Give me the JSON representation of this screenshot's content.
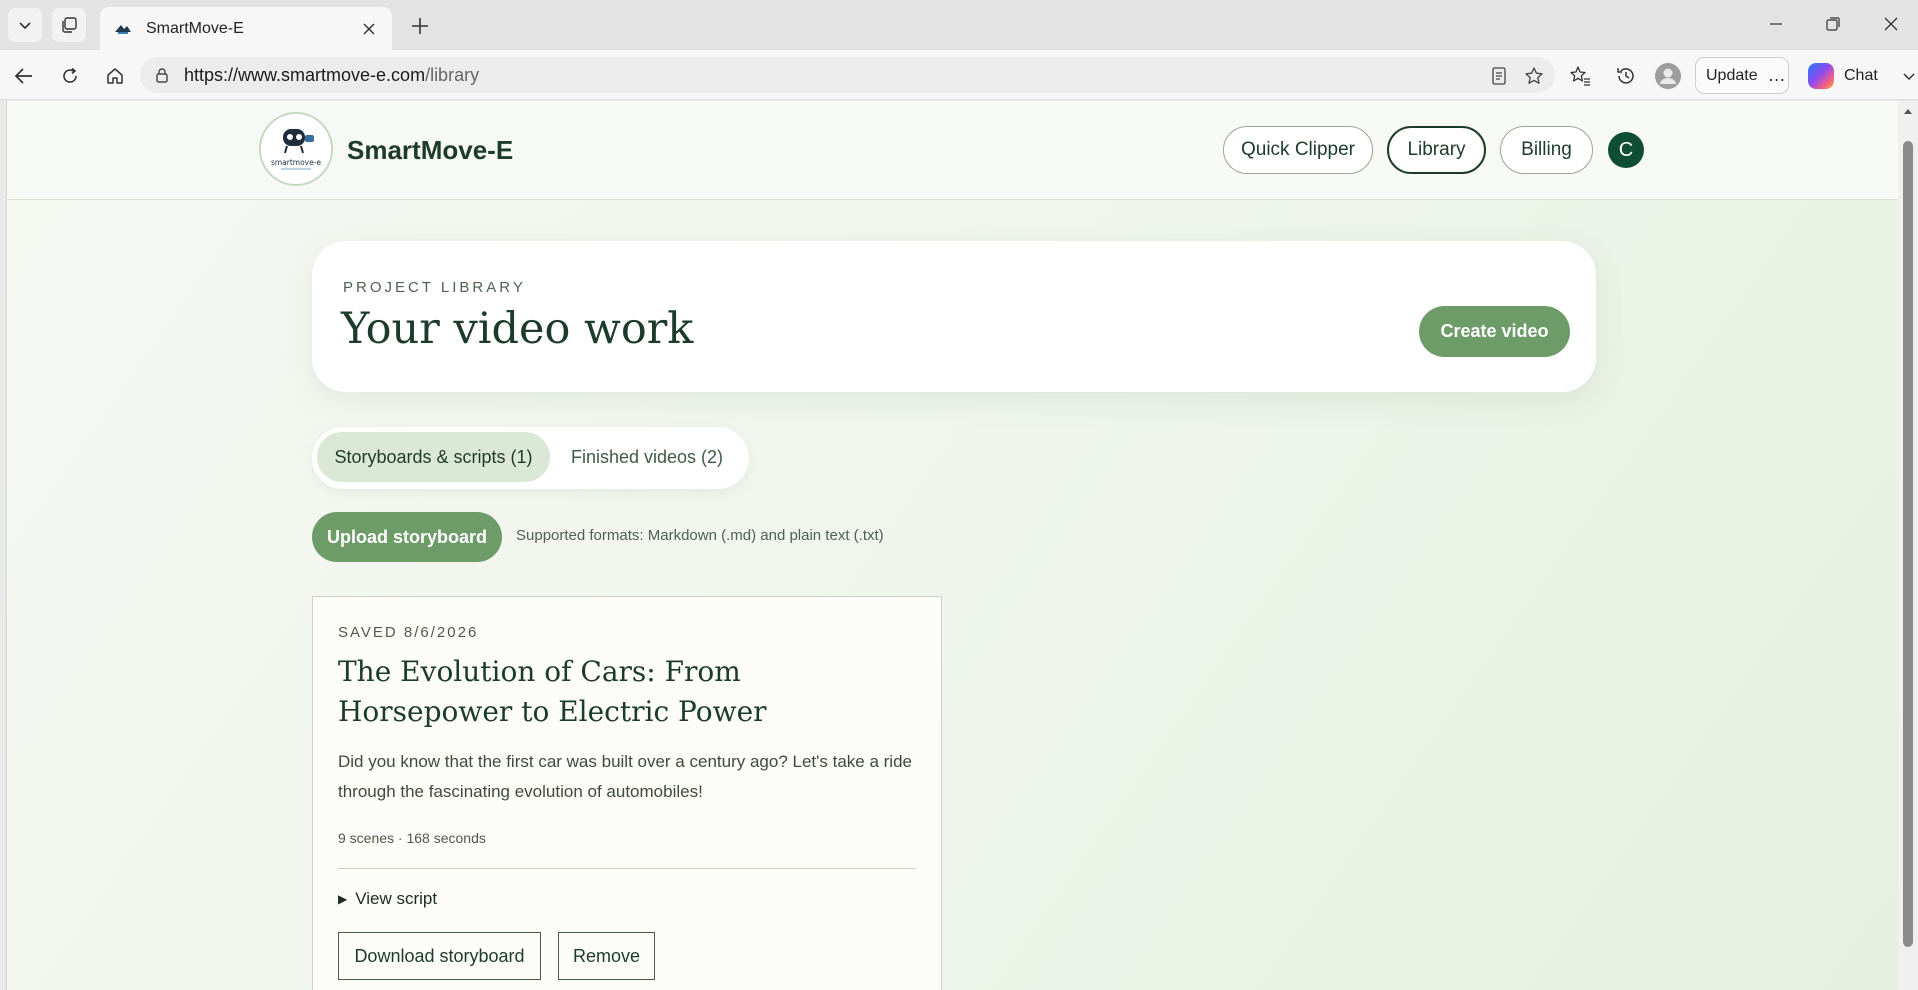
{
  "browser": {
    "tab_title": "SmartMove-E",
    "url_host": "https://www.smartmove-e.com",
    "url_path": "/library",
    "update_label": "Update",
    "update_more": "…",
    "chat_label": "Chat"
  },
  "header": {
    "brand": "SmartMove-E",
    "logo_text": "smartmove-e",
    "nav": {
      "quick_clipper": "Quick Clipper",
      "library": "Library",
      "billing": "Billing"
    },
    "avatar_initial": "C"
  },
  "hero": {
    "eyebrow": "PROJECT LIBRARY",
    "title": "Your video work",
    "create_label": "Create video"
  },
  "tabs": {
    "storyboards": "Storyboards & scripts (1)",
    "finished": "Finished videos (2)"
  },
  "upload": {
    "button_label": "Upload storyboard",
    "formats_note": "Supported formats: Markdown (.md) and plain text (.txt)"
  },
  "card": {
    "saved": "SAVED 8/6/2026",
    "title": "The Evolution of Cars: From Horsepower to Electric Power",
    "description": "Did you know that the first car was built over a century ago? Let's take a ride through the fascinating evolution of automobiles!",
    "meta": "9 scenes · 168 seconds",
    "view_script": "View script",
    "download_label": "Download storyboard",
    "remove_label": "Remove"
  },
  "colors": {
    "brand_dark": "#1d3b2a",
    "accent_green": "#6d9c68",
    "avatar_bg": "#0f4d34"
  }
}
